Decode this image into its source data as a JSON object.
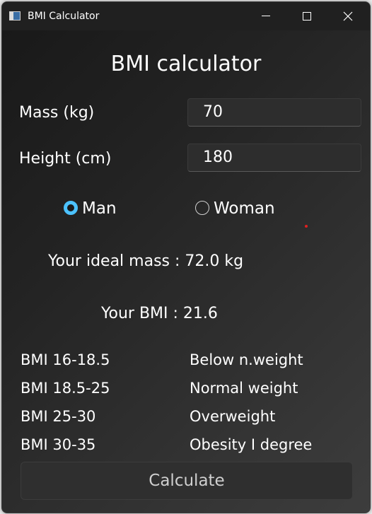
{
  "window": {
    "title": "BMI Calculator"
  },
  "form": {
    "heading": "BMI calculator",
    "mass_label": "Mass (kg)",
    "mass_value": "70",
    "height_label": "Height (cm)",
    "height_value": "180",
    "gender": {
      "options": [
        "Man",
        "Woman"
      ],
      "selected": "Man"
    }
  },
  "results": {
    "ideal_mass_text": "Your ideal mass : 72.0 kg",
    "bmi_text": "Your BMI : 21.6"
  },
  "bmi_table": [
    {
      "range": "BMI 16-18.5",
      "category": "Below n.weight"
    },
    {
      "range": "BMI 18.5-25",
      "category": "Normal weight"
    },
    {
      "range": "BMI 25-30",
      "category": "Overweight"
    },
    {
      "range": "BMI 30-35",
      "category": "Obesity I degree"
    }
  ],
  "actions": {
    "calculate_label": "Calculate"
  },
  "colors": {
    "accent": "#4cc2ff",
    "background_dark": "#181818",
    "text": "#ffffff"
  }
}
